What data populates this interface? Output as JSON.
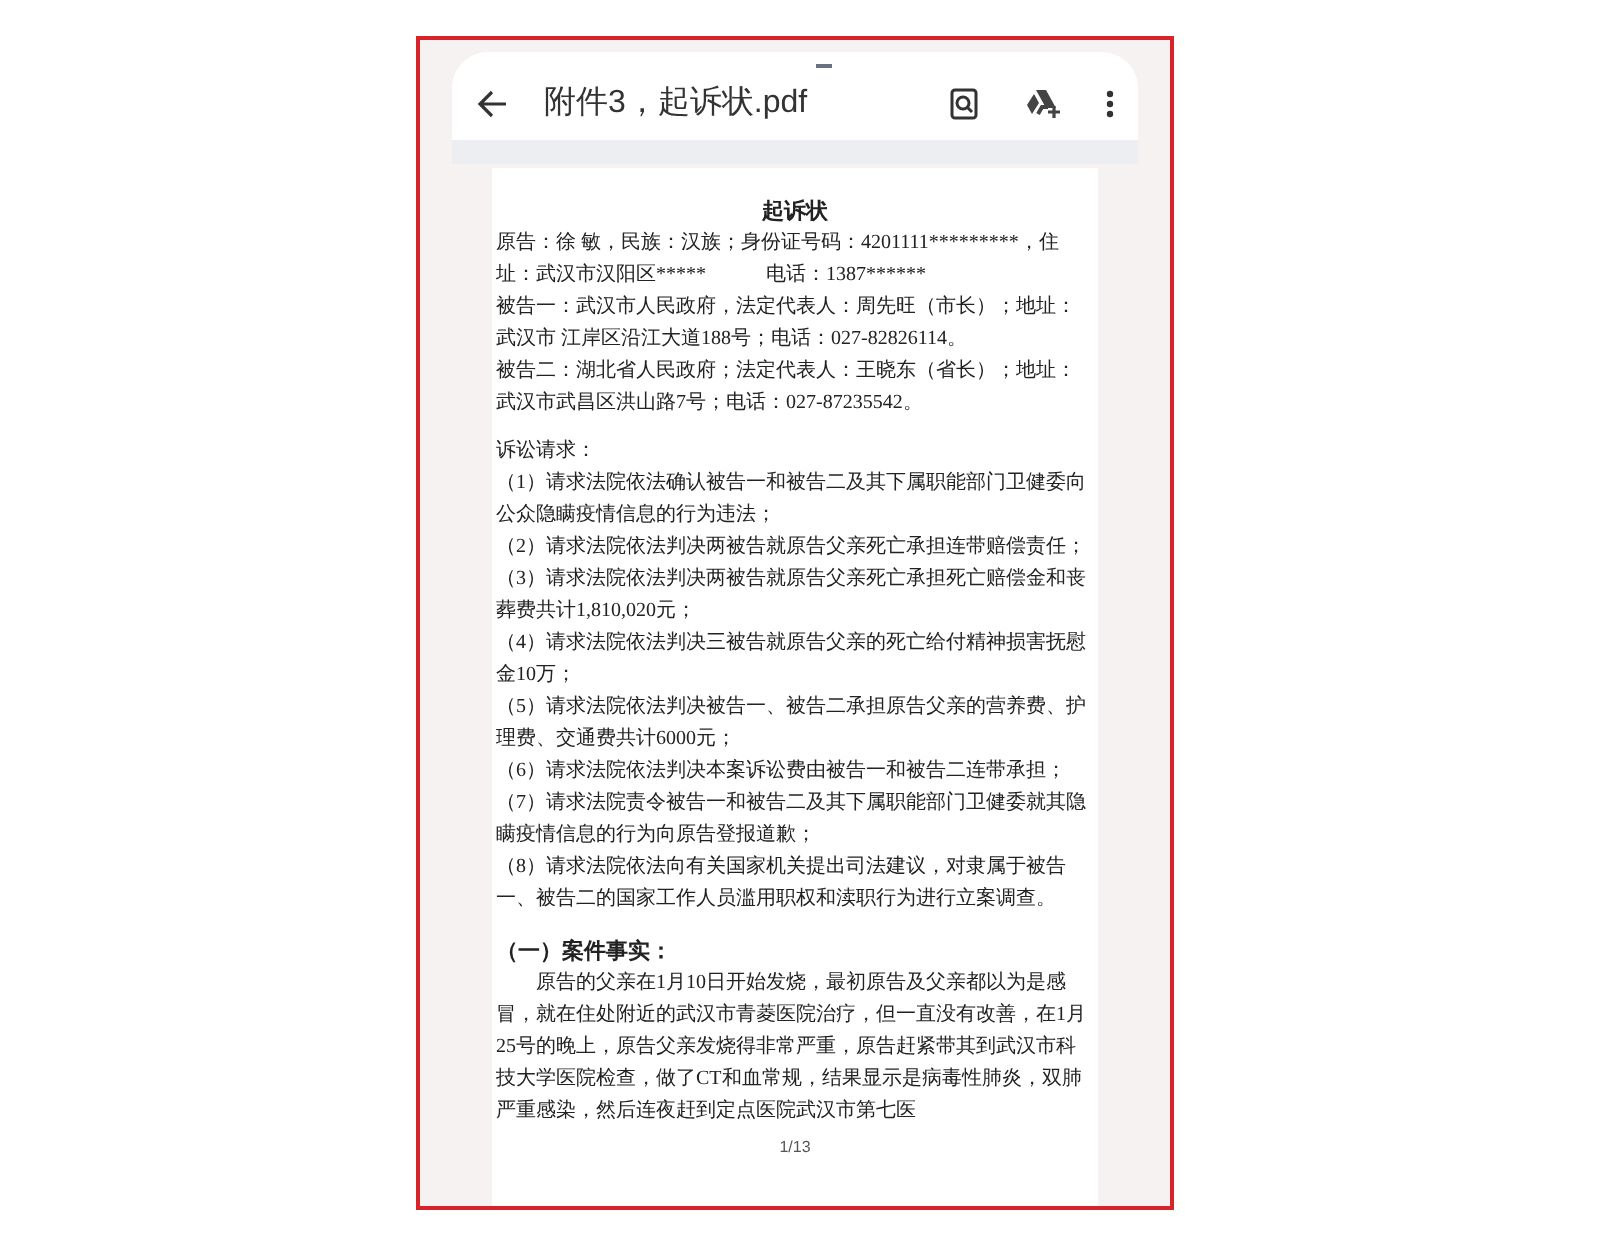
{
  "header": {
    "title": "附件3，起诉状.pdf"
  },
  "document": {
    "title": "起诉状",
    "parties": [
      "原告：徐 敏，民族：汉族；身份证号码：4201111*********，住址：武汉市汉阳区*****　　　电话：1387******",
      "被告一：武汉市人民政府，法定代表人：周先旺（市长）；地址：武汉市 江岸区沿江大道188号；电话：027-82826114。",
      "被告二：湖北省人民政府；法定代表人：王晓东（省长）；地址：武汉市武昌区洪山路7号；电话：027-87235542。"
    ],
    "claims_heading": "诉讼请求：",
    "claims": [
      "（1）请求法院依法确认被告一和被告二及其下属职能部门卫健委向公众隐瞒疫情信息的行为违法；",
      "（2）请求法院依法判决两被告就原告父亲死亡承担连带赔偿责任；",
      "（3）请求法院依法判决两被告就原告父亲死亡承担死亡赔偿金和丧葬费共计1,810,020元；",
      "（4）请求法院依法判决三被告就原告父亲的死亡给付精神损害抚慰金10万；",
      "（5）请求法院依法判决被告一、被告二承担原告父亲的营养费、护理费、交通费共计6000元；",
      "（6）请求法院依法判决本案诉讼费由被告一和被告二连带承担；",
      "（7）请求法院责令被告一和被告二及其下属职能部门卫健委就其隐瞒疫情信息的行为向原告登报道歉；",
      "（8）请求法院依法向有关国家机关提出司法建议，对隶属于被告一、被告二的国家工作人员滥用职权和渎职行为进行立案调查。"
    ],
    "section_heading": "（一）案件事实：",
    "section_body": "原告的父亲在1月10日开始发烧，最初原告及父亲都以为是感冒，就在住处附近的武汉市青菱医院治疗，但一直没有改善，在1月25号的晚上，原告父亲发烧得非常严重，原告赶紧带其到武汉市科技大学医院检查，做了CT和血常规，结果显示是病毒性肺炎，双肺严重感染，然后连夜赶到定点医院武汉市第七医",
    "page_indicator": "1/13"
  }
}
